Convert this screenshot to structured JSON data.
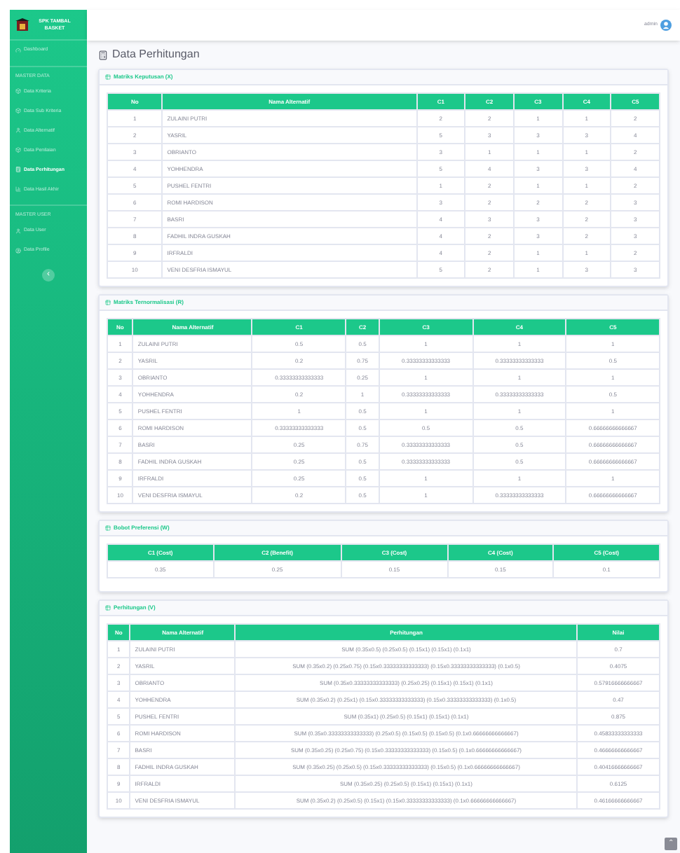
{
  "sidebar": {
    "brand": "SPK TAMBAL BASKET",
    "items": [
      {
        "kind": "link",
        "label": "Dashboard",
        "selected": false
      },
      {
        "kind": "heading",
        "label": "MASTER DATA"
      },
      {
        "kind": "link",
        "label": "Data Kriteria",
        "selected": false
      },
      {
        "kind": "link",
        "label": "Data Sub Kriteria",
        "selected": false
      },
      {
        "kind": "link",
        "label": "Data Alternatif",
        "selected": false
      },
      {
        "kind": "link",
        "label": "Data Penilaian",
        "selected": false
      },
      {
        "kind": "link",
        "label": "Data Perhitungan",
        "selected": true
      },
      {
        "kind": "link",
        "label": "Data Hasil Akhir",
        "selected": false
      },
      {
        "kind": "heading",
        "label": "MASTER USER"
      },
      {
        "kind": "link",
        "label": "Data User",
        "selected": false
      },
      {
        "kind": "link",
        "label": "Data Profile",
        "selected": false
      }
    ],
    "toggle": "‹"
  },
  "topbar": {
    "user": "admin"
  },
  "page_title": "Data Perhitungan",
  "cards": [
    {
      "title": "Matriks Keputusan (X)",
      "columns": [
        "No",
        "Nama Alternatif",
        "C1",
        "C2",
        "C3",
        "C4",
        "C5"
      ],
      "rows": [
        [
          "1",
          "ZULAINI PUTRI",
          "2",
          "2",
          "1",
          "1",
          "2"
        ],
        [
          "2",
          "YASRIL",
          "5",
          "3",
          "3",
          "3",
          "4"
        ],
        [
          "3",
          "OBRIANTO",
          "3",
          "1",
          "1",
          "1",
          "2"
        ],
        [
          "4",
          "YOHHENDRA",
          "5",
          "4",
          "3",
          "3",
          "4"
        ],
        [
          "5",
          "PUSHEL FENTRI",
          "1",
          "2",
          "1",
          "1",
          "2"
        ],
        [
          "6",
          "ROMI HARDISON",
          "3",
          "2",
          "2",
          "2",
          "3"
        ],
        [
          "7",
          "BASRI",
          "4",
          "3",
          "3",
          "2",
          "3"
        ],
        [
          "8",
          "FADHIL INDRA GUSKAH",
          "4",
          "2",
          "3",
          "2",
          "3"
        ],
        [
          "9",
          "IRFRALDI",
          "4",
          "2",
          "1",
          "1",
          "2"
        ],
        [
          "10",
          "VENI DESFRIA ISMAYUL",
          "5",
          "2",
          "1",
          "3",
          "3"
        ]
      ]
    },
    {
      "title": "Matriks Ternormalisasi (R)",
      "columns": [
        "No",
        "Nama Alternatif",
        "C1",
        "C2",
        "C3",
        "C4",
        "C5"
      ],
      "rows": [
        [
          "1",
          "ZULAINI PUTRI",
          "0.5",
          "0.5",
          "1",
          "1",
          "1"
        ],
        [
          "2",
          "YASRIL",
          "0.2",
          "0.75",
          "0.33333333333333",
          "0.33333333333333",
          "0.5"
        ],
        [
          "3",
          "OBRIANTO",
          "0.33333333333333",
          "0.25",
          "1",
          "1",
          "1"
        ],
        [
          "4",
          "YOHHENDRA",
          "0.2",
          "1",
          "0.33333333333333",
          "0.33333333333333",
          "0.5"
        ],
        [
          "5",
          "PUSHEL FENTRI",
          "1",
          "0.5",
          "1",
          "1",
          "1"
        ],
        [
          "6",
          "ROMI HARDISON",
          "0.33333333333333",
          "0.5",
          "0.5",
          "0.5",
          "0.66666666666667"
        ],
        [
          "7",
          "BASRI",
          "0.25",
          "0.75",
          "0.33333333333333",
          "0.5",
          "0.66666666666667"
        ],
        [
          "8",
          "FADHIL INDRA GUSKAH",
          "0.25",
          "0.5",
          "0.33333333333333",
          "0.5",
          "0.66666666666667"
        ],
        [
          "9",
          "IRFRALDI",
          "0.25",
          "0.5",
          "1",
          "1",
          "1"
        ],
        [
          "10",
          "VENI DESFRIA ISMAYUL",
          "0.2",
          "0.5",
          "1",
          "0.33333333333333",
          "0.66666666666667"
        ]
      ]
    },
    {
      "title": "Bobot Preferensi (W)",
      "columns": [
        "C1 (Cost)",
        "C2 (Benefit)",
        "C3 (Cost)",
        "C4 (Cost)",
        "C5 (Cost)"
      ],
      "rows": [
        [
          "0.35",
          "0.25",
          "0.15",
          "0.15",
          "0.1"
        ]
      ]
    },
    {
      "title": "Perhitungan (V)",
      "columns": [
        "No",
        "Nama Alternatif",
        "Perhitungan",
        "Nilai"
      ],
      "rows": [
        [
          "1",
          "ZULAINI PUTRI",
          "SUM (0.35x0.5) (0.25x0.5) (0.15x1) (0.15x1) (0.1x1)",
          "0.7"
        ],
        [
          "2",
          "YASRIL",
          "SUM (0.35x0.2) (0.25x0.75) (0.15x0.33333333333333) (0.15x0.33333333333333) (0.1x0.5)",
          "0.4075"
        ],
        [
          "3",
          "OBRIANTO",
          "SUM (0.35x0.33333333333333) (0.25x0.25) (0.15x1) (0.15x1) (0.1x1)",
          "0.57916666666667"
        ],
        [
          "4",
          "YOHHENDRA",
          "SUM (0.35x0.2) (0.25x1) (0.15x0.33333333333333) (0.15x0.33333333333333) (0.1x0.5)",
          "0.47"
        ],
        [
          "5",
          "PUSHEL FENTRI",
          "SUM (0.35x1) (0.25x0.5) (0.15x1) (0.15x1) (0.1x1)",
          "0.875"
        ],
        [
          "6",
          "ROMI HARDISON",
          "SUM (0.35x0.33333333333333) (0.25x0.5) (0.15x0.5) (0.15x0.5) (0.1x0.66666666666667)",
          "0.45833333333333"
        ],
        [
          "7",
          "BASRI",
          "SUM (0.35x0.25) (0.25x0.75) (0.15x0.33333333333333) (0.15x0.5) (0.1x0.66666666666667)",
          "0.46666666666667"
        ],
        [
          "8",
          "FADHIL INDRA GUSKAH",
          "SUM (0.35x0.25) (0.25x0.5) (0.15x0.33333333333333) (0.15x0.5) (0.1x0.66666666666667)",
          "0.40416666666667"
        ],
        [
          "9",
          "IRFRALDI",
          "SUM (0.35x0.25) (0.25x0.5) (0.15x1) (0.15x1) (0.1x1)",
          "0.6125"
        ],
        [
          "10",
          "VENI DESFRIA ISMAYUL",
          "SUM (0.35x0.2) (0.25x0.5) (0.15x1) (0.15x0.33333333333333) (0.1x0.66666666666667)",
          "0.46166666666667"
        ]
      ]
    }
  ],
  "scroll_top": "⌃"
}
